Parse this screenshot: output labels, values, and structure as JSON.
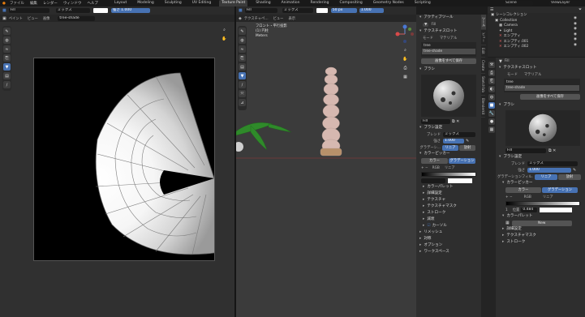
{
  "menu": {
    "items": [
      "ファイル",
      "編集",
      "レンダー",
      "ウィンドウ",
      "ヘルプ"
    ],
    "workspaces": [
      "Layout",
      "Modeling",
      "Sculpting",
      "UV Editing",
      "Texture Paint",
      "Shading",
      "Animation",
      "Rendering",
      "Compositing",
      "Geometry Nodes",
      "Scripting"
    ],
    "active_workspace": "Texture Paint",
    "scene": "Scene",
    "view_layer": "ViewLayer"
  },
  "image_editor": {
    "mode": "ペイント",
    "menus": [
      "ビュー",
      "画像"
    ],
    "image_name": "tree-shade",
    "brush": "Fill",
    "blend": "ミックス",
    "color_hex": "#ffffff",
    "strength_label": "強さ",
    "strength": "1.000"
  },
  "viewport": {
    "mode": "テクスチャペ...",
    "menus": [
      "ビュー",
      "表示"
    ],
    "brush": "Fill",
    "blend": "ミックス",
    "radius": "50 px",
    "strength": "1.000",
    "overlay_line1": "フロント・平行投影",
    "overlay_line2": "(1) 円柱",
    "overlay_line3": "Meters"
  },
  "tool_panel": {
    "active_tool": "アクティブツール",
    "tool_name": "Fill",
    "texture_slots": "テクスチャスロット",
    "mode_label": "モード",
    "mode_value": "マテリアル",
    "slots": [
      "tree",
      "tree-shade"
    ],
    "save_all": "画像をすべて保存",
    "brushes": "ブラシ",
    "brush_name": "Fill",
    "brush_settings": "ブラシ設定",
    "blend_label": "ブレンド",
    "blend_value": "ミックス",
    "strength_label": "強さ",
    "strength": "1.000",
    "gradient_label": "グラデーシ...",
    "gradient_value": "リニア",
    "gradient_btn2": "放射",
    "color_picker": "カラーピッカー",
    "color_tabs": [
      "カラー",
      "グラデーション"
    ],
    "color_mode": "RGB",
    "interp_value": "リニア",
    "sub_sections": [
      "カラーパレット",
      "詳細設定",
      "テクスチャ",
      "テクスチャマスク",
      "ストローク",
      "減衰",
      "カーソル"
    ],
    "more_sections": [
      "対称",
      "オプション",
      "ワークスペース"
    ],
    "sym_label": "リメッシュ"
  },
  "outliner": {
    "title": "シーンコレクション",
    "rows": [
      "Collection",
      "Camera",
      "Light",
      "エンプティ",
      "エンプティ.001",
      "エンプティ.002"
    ]
  },
  "properties": {
    "brush_name": "Fill",
    "texture_slots": "テクスチャスロット",
    "mode_label": "モード",
    "mode_value": "マテリアル",
    "slots": [
      "tree",
      "tree-shade"
    ],
    "save_all": "画像をすべて保存",
    "brushes": "ブラシ",
    "brush_settings": "ブラシ設定",
    "blend_label": "ブレンド",
    "blend_value": "ミックス",
    "strength_label": "強さ",
    "strength": "1.000",
    "gradient_label": "グラデーションフィル...",
    "gradient_value": "リニア",
    "gradient_btn2": "放射",
    "color_picker": "カラーピッカー",
    "color_tabs": [
      "カラー",
      "グラデーション"
    ],
    "color_mode": "RGB",
    "interp_value": "リニア",
    "pos_label": "位置",
    "pos_value": "0.484",
    "palette": "カラーパレット",
    "new_label": "New",
    "sub_sections": [
      "詳細設定",
      "テクスチャマスク",
      "ストローク"
    ]
  },
  "right_vtabs": [
    "ツール",
    "ビュー",
    "Edit",
    "Create",
    "Sketchfab",
    "Blenderkit"
  ],
  "colors": {
    "accent": "#4772b3",
    "floor_line": "#7a3838",
    "vine": "#2f8a2a",
    "column": "#d6b8b0",
    "base": "#b8906a"
  }
}
